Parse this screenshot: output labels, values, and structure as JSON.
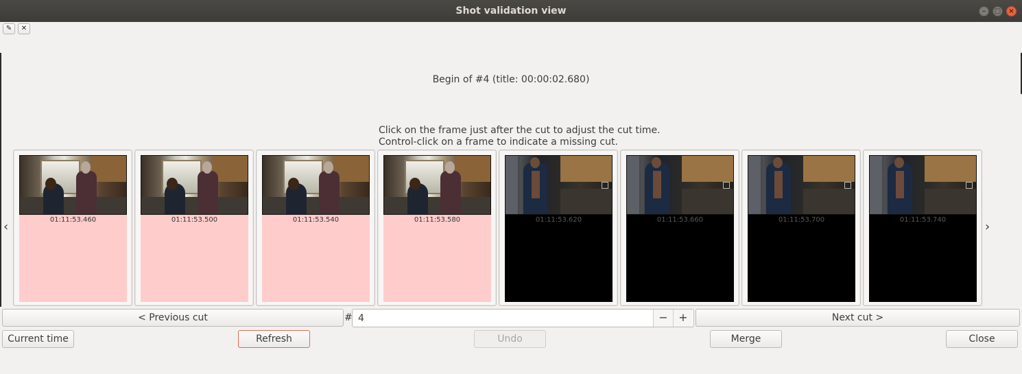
{
  "window": {
    "title": "Shot validation view",
    "controls": [
      "minimize-icon",
      "maximize-icon",
      "close-icon"
    ]
  },
  "toolbar": {
    "edit_icon": "edit-icon",
    "close_icon": "close-icon",
    "edit_glyph": "✎",
    "close_glyph": "✕"
  },
  "cut": {
    "title": "Begin of #4 (title: 00:00:02.680)",
    "hint_line1": "Click on the frame just after the cut to adjust the cut time.",
    "hint_line2": "Control-click on a frame to indicate a missing cut."
  },
  "nav": {
    "left_arrow": "‹",
    "right_arrow": "›"
  },
  "frames": [
    {
      "time": "01:11:53.460",
      "side": "before"
    },
    {
      "time": "01:11:53.500",
      "side": "before"
    },
    {
      "time": "01:11:53.540",
      "side": "before"
    },
    {
      "time": "01:11:53.580",
      "side": "before"
    },
    {
      "time": "01:11:53.620",
      "side": "after"
    },
    {
      "time": "01:11:53.660",
      "side": "after"
    },
    {
      "time": "01:11:53.700",
      "side": "after"
    },
    {
      "time": "01:11:53.740",
      "side": "after"
    }
  ],
  "colors": {
    "before_bg": "#ffcccc",
    "after_bg": "#000000",
    "accent": "#e06c4f"
  },
  "controls": {
    "previous_cut": "< Previous cut",
    "next_cut": "Next cut >",
    "hash": "#",
    "cut_number": "4",
    "minus": "−",
    "plus": "+",
    "current_time": "Current time",
    "refresh": "Refresh",
    "undo": "Undo",
    "merge": "Merge",
    "close": "Close"
  }
}
